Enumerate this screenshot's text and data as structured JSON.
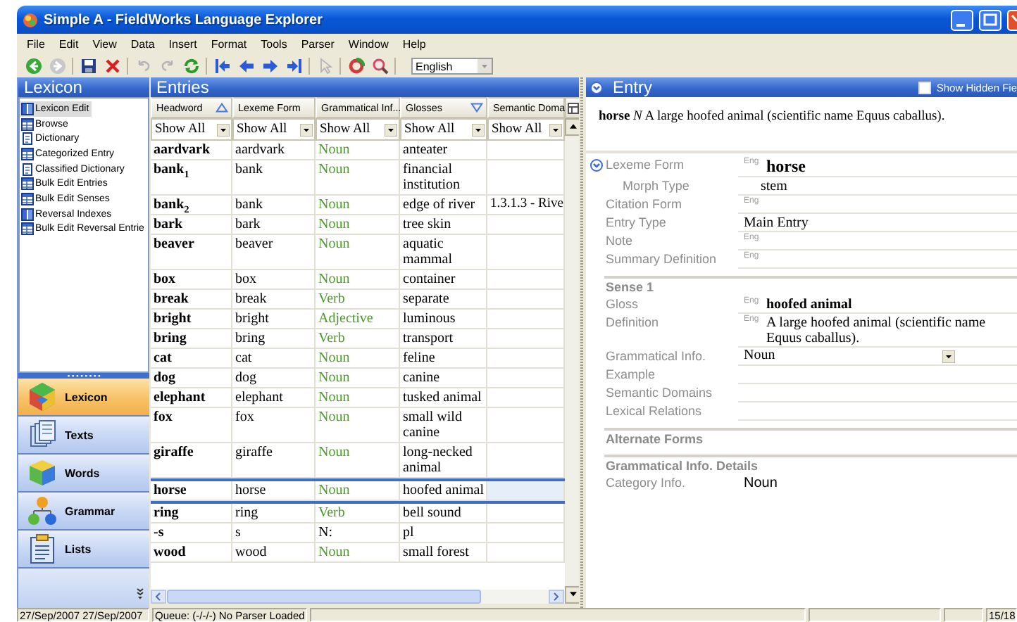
{
  "window": {
    "title": "Simple A - FieldWorks Language Explorer"
  },
  "menu": [
    "File",
    "Edit",
    "View",
    "Data",
    "Insert",
    "Format",
    "Tools",
    "Parser",
    "Window",
    "Help"
  ],
  "toolbar": {
    "groups": [
      [
        {
          "kind": "back",
          "disabled": false
        },
        {
          "kind": "forward",
          "disabled": true
        }
      ],
      [
        {
          "kind": "save",
          "disabled": false
        },
        {
          "kind": "delete",
          "disabled": false
        }
      ],
      [
        {
          "kind": "undo",
          "disabled": true
        },
        {
          "kind": "redo",
          "disabled": true
        },
        {
          "kind": "refresh",
          "disabled": false
        }
      ],
      [
        {
          "kind": "first",
          "disabled": false
        },
        {
          "kind": "previous",
          "disabled": false
        },
        {
          "kind": "next",
          "disabled": false
        },
        {
          "kind": "last",
          "disabled": false
        }
      ],
      [
        {
          "kind": "cursor",
          "disabled": true
        }
      ],
      [
        {
          "kind": "cycle",
          "disabled": false
        },
        {
          "kind": "search",
          "disabled": false
        }
      ]
    ],
    "writing_system": "English"
  },
  "sidebar": {
    "title": "Lexicon",
    "views": [
      {
        "label": "Lexicon Edit",
        "kind": "split",
        "selected": true
      },
      {
        "label": "Browse",
        "kind": "table",
        "selected": false
      },
      {
        "label": "Dictionary",
        "kind": "doc",
        "selected": false
      },
      {
        "label": "Categorized Entry",
        "kind": "table",
        "selected": false
      },
      {
        "label": "Classified Dictionary",
        "kind": "doc",
        "selected": false
      },
      {
        "label": "Bulk Edit Entries",
        "kind": "table",
        "selected": false
      },
      {
        "label": "Bulk Edit Senses",
        "kind": "table",
        "selected": false
      },
      {
        "label": "Reversal Indexes",
        "kind": "split",
        "selected": false
      },
      {
        "label": "Bulk Edit Reversal Entrie",
        "kind": "table",
        "selected": false
      }
    ],
    "areas": [
      {
        "label": "Lexicon",
        "kind": "lexicon",
        "selected": true
      },
      {
        "label": "Texts",
        "kind": "texts",
        "selected": false
      },
      {
        "label": "Words",
        "kind": "words",
        "selected": false
      },
      {
        "label": "Grammar",
        "kind": "grammar",
        "selected": false
      },
      {
        "label": "Lists",
        "kind": "lists",
        "selected": false
      }
    ]
  },
  "entries": {
    "title": "Entries",
    "columns": [
      {
        "label": "Headword",
        "sorted": true,
        "descending": false
      },
      {
        "label": "Lexeme Form",
        "sorted": false
      },
      {
        "label": "Grammatical Inf...",
        "sorted": false
      },
      {
        "label": "Glosses",
        "sorted": true,
        "descending": true
      },
      {
        "label": "Semantic Doma",
        "sorted": false
      }
    ],
    "filters": [
      "Show All",
      "Show All",
      "Show All",
      "Show All",
      "Show All"
    ],
    "rows": [
      {
        "headword": "aardvark",
        "lexeme_form": "aardvark",
        "grammatical_info": "Noun",
        "color": "#4c9a2a",
        "glosses": "anteater",
        "selected": false
      },
      {
        "headword": "bank$_{1}$",
        "lexeme_form": "bank",
        "grammatical_info": "Noun",
        "color": "#4c9a2a",
        "glosses": "financial institution",
        "selected": false
      },
      {
        "headword": "bank$_{2}$",
        "lexeme_form": "bank",
        "grammatical_info": "Noun",
        "color": "#4c9a2a",
        "glosses": "edge of river",
        "semantic_domain": "1.3.1.3 - Rive",
        "selected": false
      },
      {
        "headword": "bark",
        "lexeme_form": "bark",
        "grammatical_info": "Noun",
        "color": "#4c9a2a",
        "glosses": "tree skin",
        "selected": false
      },
      {
        "headword": "beaver",
        "lexeme_form": "beaver",
        "grammatical_info": "Noun",
        "color": "#4c9a2a",
        "glosses": "aquatic mammal",
        "selected": false
      },
      {
        "headword": "box",
        "lexeme_form": "box",
        "grammatical_info": "Noun",
        "color": "#4c9a2a",
        "glosses": "container",
        "selected": false
      },
      {
        "headword": "break",
        "lexeme_form": "break",
        "grammatical_info": "Verb",
        "color": "#4c9a2a",
        "glosses": "separate",
        "selected": false
      },
      {
        "headword": "bright",
        "lexeme_form": "bright",
        "grammatical_info": "Adjective",
        "color": "#4c9a2a",
        "glosses": "luminous",
        "selected": false
      },
      {
        "headword": "bring",
        "lexeme_form": "bring",
        "grammatical_info": "Verb",
        "color": "#4c9a2a",
        "glosses": "transport",
        "selected": false
      },
      {
        "headword": "cat",
        "lexeme_form": "cat",
        "grammatical_info": "Noun",
        "color": "#4c9a2a",
        "glosses": "feline",
        "selected": false
      },
      {
        "headword": "dog",
        "lexeme_form": "dog",
        "grammatical_info": "Noun",
        "color": "#4c9a2a",
        "glosses": "canine",
        "selected": false
      },
      {
        "headword": "elephant",
        "lexeme_form": "elephant",
        "grammatical_info": "Noun",
        "color": "#4c9a2a",
        "glosses": "tusked animal",
        "selected": false
      },
      {
        "headword": "fox",
        "lexeme_form": "fox",
        "grammatical_info": "Noun",
        "color": "#4c9a2a",
        "glosses": "small wild canine",
        "selected": false
      },
      {
        "headword": "giraffe",
        "lexeme_form": "giraffe",
        "grammatical_info": "Noun",
        "color": "#4c9a2a",
        "glosses": "long-necked animal",
        "selected": false
      },
      {
        "headword": "horse",
        "lexeme_form": "horse",
        "grammatical_info": "Noun",
        "color": "#4c9a2a",
        "glosses": "hoofed animal",
        "selected": true
      },
      {
        "headword": "ring",
        "lexeme_form": "ring",
        "grammatical_info": "Verb",
        "color": "#4c9a2a",
        "glosses": "bell sound",
        "selected": false
      },
      {
        "headword": "-s",
        "lexeme_form": "s",
        "grammatical_info": "N:",
        "color": "#000000",
        "glosses": "pl",
        "selected": false
      },
      {
        "headword": "wood",
        "lexeme_form": "wood",
        "grammatical_info": "Noun",
        "color": "#4c9a2a",
        "glosses": "small forest",
        "selected": false
      }
    ]
  },
  "entry": {
    "title": "Entry",
    "expanded": true,
    "show_hidden": {
      "label": "Show Hidden Fie",
      "checked": false
    },
    "summary": {
      "headword": "horse",
      "pos": "N",
      "definition": "A large hoofed animal (scientific name Equus caballus)."
    },
    "sections": [
      {
        "fields": [
          {
            "label": "Lexeme Form",
            "ws": "Eng",
            "value": "horse",
            "kind": "large",
            "expanded": true,
            "children": [
              {
                "label": "Morph Type",
                "value": "stem",
                "kind": "text"
              }
            ]
          },
          {
            "label": "Citation Form",
            "ws": "Eng",
            "kind": "text"
          },
          {
            "label": "Entry Type",
            "value": "Main Entry",
            "kind": "text"
          },
          {
            "label": "Note",
            "ws": "Eng",
            "kind": "text"
          },
          {
            "label": "Summary Definition",
            "ws": "Eng",
            "kind": "text"
          }
        ]
      },
      {
        "heading": "Sense 1",
        "fields": [
          {
            "label": "Gloss",
            "ws": "Eng",
            "value": "hoofed animal",
            "kind": "bold"
          },
          {
            "label": "Definition",
            "ws": "Eng",
            "value": "A large hoofed animal (scientific name Equus caballus).",
            "kind": "text"
          },
          {
            "label": "Grammatical Info.",
            "value": "Noun",
            "kind": "dropdown"
          },
          {
            "label": "Example",
            "kind": "text"
          },
          {
            "label": "Semantic Domains",
            "kind": "text"
          },
          {
            "label": "Lexical Relations",
            "kind": "text"
          }
        ]
      },
      {
        "heading": "Alternate Forms"
      },
      {
        "heading": "Grammatical Info. Details",
        "fields": [
          {
            "label": "Category Info.",
            "value": "Noun",
            "kind": "plain"
          }
        ]
      }
    ]
  },
  "status_bar": {
    "dates": "27/Sep/2007 27/Sep/2007",
    "parser": "Queue: (-/-/-) No Parser Loaded",
    "position": "15/18"
  }
}
